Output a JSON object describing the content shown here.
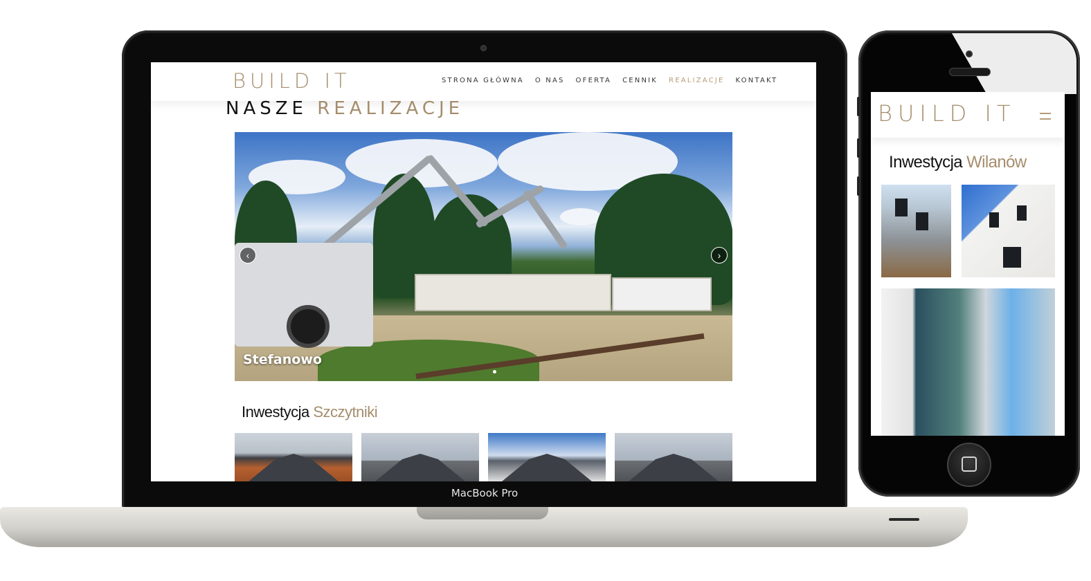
{
  "laptop": {
    "brand": "MacBook Pro",
    "site": {
      "logo": "BUILD IT",
      "nav": [
        {
          "label": "STRONA GŁÓWNA",
          "active": false
        },
        {
          "label": "O NAS",
          "active": false
        },
        {
          "label": "OFERTA",
          "active": false
        },
        {
          "label": "CENNIK",
          "active": false
        },
        {
          "label": "REALIZACJE",
          "active": true
        },
        {
          "label": "KONTAKT",
          "active": false
        }
      ],
      "page_title": {
        "part1": "NASZE",
        "part2": "REALIZACJE"
      },
      "slider": {
        "caption": "Stefanowo",
        "prev": "‹",
        "next": "›"
      },
      "section": {
        "part1": "Inwestycja",
        "part2": "Szczytniki"
      }
    }
  },
  "phone": {
    "logo": "BUILD IT",
    "section": {
      "part1": "Inwestycja",
      "part2": "Wilanów"
    }
  },
  "colors": {
    "accent": "#a58d6c",
    "nav_active": "#b59c78",
    "text": "#111111"
  },
  "icons": {
    "prev": "chevron-left-icon",
    "next": "chevron-right-icon",
    "menu": "hamburger-icon"
  }
}
